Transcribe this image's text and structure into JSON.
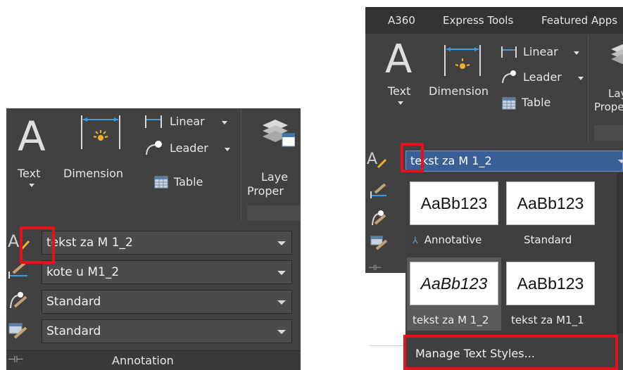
{
  "left": {
    "buttons": {
      "text": "Text",
      "dimension": "Dimension",
      "linear": "Linear",
      "leader": "Leader",
      "table": "Table",
      "layer_line1": "Laye",
      "layer_line2": "Proper"
    },
    "combos": [
      {
        "value": "tekst za M 1_2"
      },
      {
        "value": "kote u M1_2"
      },
      {
        "value": "Standard"
      },
      {
        "value": "Standard"
      }
    ],
    "footer": "Annotation"
  },
  "right": {
    "tabs": [
      "A360",
      "Express Tools",
      "Featured Apps"
    ],
    "buttons": {
      "text": "Text",
      "dimension": "Dimension",
      "linear": "Linear",
      "leader": "Leader",
      "table": "Table",
      "layer_line1": "Lay",
      "layer_line2": "Prope"
    },
    "style_combo": "tekst za M 1_2",
    "gallery": [
      {
        "sample": "AaBb123",
        "label": "Annotative",
        "italic": false
      },
      {
        "sample": "AaBb123",
        "label": "Standard",
        "italic": false
      },
      {
        "sample": "AaBb123",
        "label": "tekst za M 1_2",
        "italic": true
      },
      {
        "sample": "AaBb123",
        "label": "tekst za M1_1",
        "italic": false
      }
    ],
    "manage": "Manage Text Styles..."
  },
  "colors": {
    "panel": "#414141",
    "highlight": "#e5121b",
    "selected_combo": "#3a5f97"
  }
}
